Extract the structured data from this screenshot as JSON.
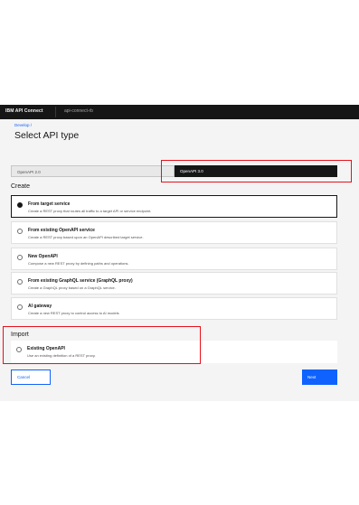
{
  "header": {
    "brand": "IBM API Connect",
    "instance": "api-connect-rb"
  },
  "page": {
    "breadcrumb": "Develop /",
    "title": "Select API type"
  },
  "tabs": [
    {
      "label": "OpenAPI 2.0",
      "selected": false
    },
    {
      "label": "OpenAPI 3.0",
      "selected": true
    }
  ],
  "create": {
    "heading": "Create",
    "options": [
      {
        "title": "From target service",
        "desc": "Create a REST proxy that routes all traffic to a target API or service endpoint.",
        "selected": true
      },
      {
        "title": "From existing OpenAPI service",
        "desc": "Create a REST proxy based upon an OpenAPI described target service.",
        "selected": false
      },
      {
        "title": "New OpenAPI",
        "desc": "Compose a new REST proxy by defining paths and operations.",
        "selected": false
      },
      {
        "title": "From existing GraphQL service (GraphQL proxy)",
        "desc": "Create a GraphQL proxy based on a GraphQL service.",
        "selected": false
      },
      {
        "title": "AI gateway",
        "desc": "Create a new REST proxy to control access to AI models",
        "selected": false
      }
    ]
  },
  "import": {
    "heading": "Import",
    "options": [
      {
        "title": "Existing OpenAPI",
        "desc": "Use an existing definition of a REST proxy.",
        "selected": false
      }
    ]
  },
  "actions": {
    "cancel_label": "Cancel",
    "next_label": "Next"
  },
  "colors": {
    "accent": "#0f62fe",
    "highlight": "#e8111a",
    "topbar": "#161616"
  }
}
